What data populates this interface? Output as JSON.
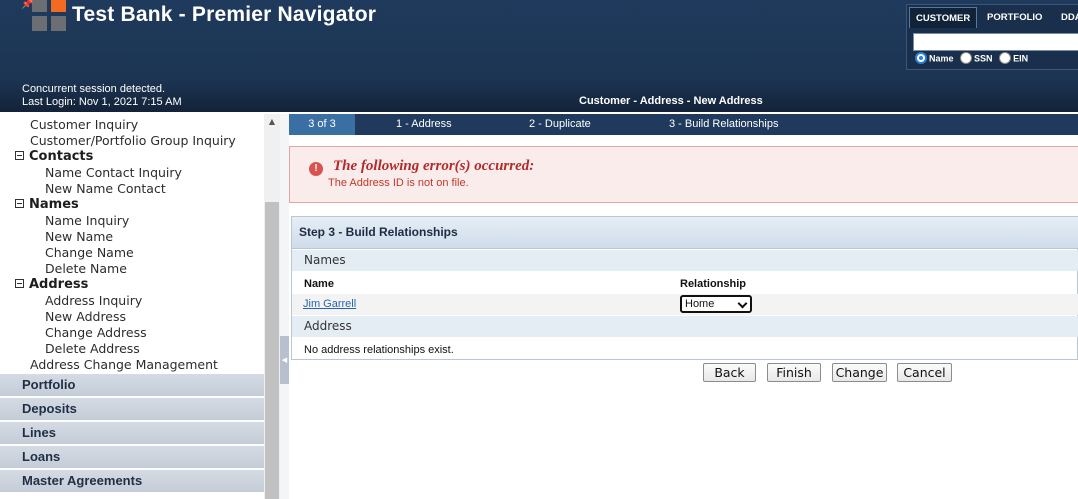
{
  "header": {
    "app_title": "Test Bank - Premier Navigator",
    "pin_glyph": "📌",
    "session_message": "Concurrent session detected.",
    "last_login": "Last Login: Nov 1, 2021 7:15 AM",
    "page_heading": "Customer - Address - New Address",
    "colors": {
      "header_bg": "#1f3a5c",
      "logo_accent": "#f26b21"
    }
  },
  "search": {
    "tabs": [
      {
        "label": "CUSTOMER",
        "active": true
      },
      {
        "label": "PORTFOLIO",
        "active": false
      },
      {
        "label": "DDA",
        "active": false
      }
    ],
    "query": "",
    "options": [
      {
        "label": "Name",
        "checked": true
      },
      {
        "label": "SSN",
        "checked": false
      },
      {
        "label": "EIN",
        "checked": false
      }
    ]
  },
  "sidebar": {
    "customer_links": [
      "Customer Inquiry",
      "Customer/Portfolio Group Inquiry"
    ],
    "groups": [
      {
        "label": "Contacts",
        "items": [
          "Name Contact Inquiry",
          "New Name Contact"
        ]
      },
      {
        "label": "Names",
        "items": [
          "Name Inquiry",
          "New Name",
          "Change Name",
          "Delete Name"
        ]
      },
      {
        "label": "Address",
        "items": [
          "Address Inquiry",
          "New Address",
          "Change Address",
          "Delete Address"
        ]
      }
    ],
    "extra_link": "Address Change Management",
    "sections": [
      "Portfolio",
      "Deposits",
      "Lines",
      "Loans",
      "Master Agreements"
    ],
    "scroll_up_glyph": "▲",
    "collapse_glyph": "◀"
  },
  "wizard": {
    "progress": "3 of 3",
    "steps": [
      "1 - Address",
      "2 - Duplicate",
      "3 - Build Relationships"
    ]
  },
  "error": {
    "icon": "!",
    "title": "The following error(s) occurred:",
    "message": "The Address ID is not on file."
  },
  "panel": {
    "title": "Step 3 - Build Relationships",
    "names_section": "Names",
    "columns": {
      "name": "Name",
      "relationship": "Relationship"
    },
    "rows": [
      {
        "name": "Jim Garrell",
        "relationship": "Home"
      }
    ],
    "address_section": "Address",
    "address_empty": "No address relationships exist."
  },
  "buttons": {
    "back": "Back",
    "finish": "Finish",
    "change": "Change",
    "cancel": "Cancel"
  }
}
